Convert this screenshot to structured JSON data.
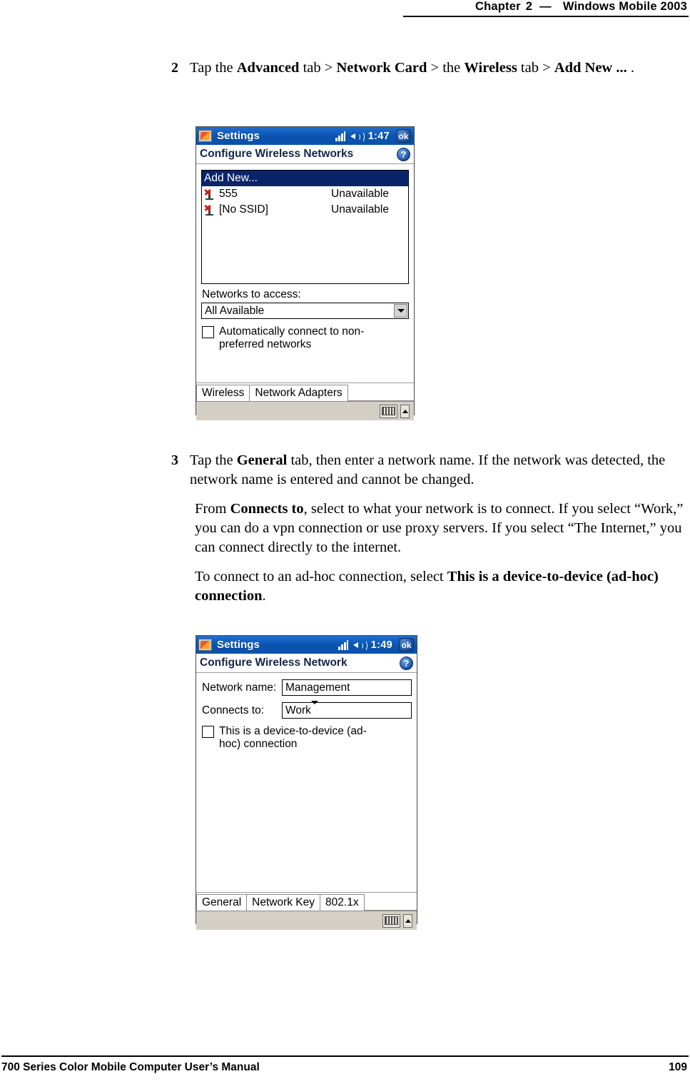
{
  "header": {
    "chapter_word": "Chapter",
    "chapter_number": "2",
    "dash": "—",
    "title": "Windows Mobile 2003"
  },
  "footer": {
    "manual_title": "700 Series Color Mobile Computer User’s Manual",
    "page_number": "109"
  },
  "steps": [
    {
      "number": "2",
      "text_html": "Tap the <b>Advanced</b> tab &gt; <b>Network Card</b> &gt; the <b>Wireless</b> tab &gt; <b>Add New ... </b>."
    },
    {
      "number": "3",
      "text_html": "Tap the <b>General</b> tab, then enter a network name. If the network was detected, the network name is entered and cannot be changed."
    }
  ],
  "paragraphs": [
    "From <b>Connects to</b>, select to what your network is to connect. If you select “Work,” you can do a vpn connection or use proxy servers. If you select “The Internet,” you can connect directly to the internet.",
    "To connect to an ad-hoc connection, select <b>This is a device-to-device (ad-hoc) connection</b>."
  ],
  "screenshot1": {
    "titlebar": {
      "title": "Settings",
      "clock": "1:47",
      "ok_label": "ok"
    },
    "subtitle": "Configure Wireless Networks",
    "help_label": "?",
    "list": [
      {
        "name": "Add New...",
        "status": "",
        "selected": true,
        "has_icon": false
      },
      {
        "name": "555",
        "status": "Unavailable",
        "selected": false,
        "has_icon": true
      },
      {
        "name": "[No SSID]",
        "status": "Unavailable",
        "selected": false,
        "has_icon": true
      }
    ],
    "networks_label": "Networks to access:",
    "networks_value": "All Available",
    "checkbox_label": "Automatically connect to non-preferred networks",
    "checkbox_checked": false,
    "tabs": [
      {
        "label": "Wireless",
        "active": true
      },
      {
        "label": "Network Adapters",
        "active": false
      }
    ]
  },
  "screenshot2": {
    "titlebar": {
      "title": "Settings",
      "clock": "1:49",
      "ok_label": "ok"
    },
    "subtitle": "Configure Wireless Network",
    "help_label": "?",
    "fields": [
      {
        "label": "Network name:",
        "value": "Management",
        "type": "text"
      },
      {
        "label": "Connects to:",
        "value": "Work",
        "type": "combo"
      }
    ],
    "checkbox_label": "This is a device-to-device (ad-hoc) connection",
    "checkbox_checked": false,
    "tabs": [
      {
        "label": "General",
        "active": true
      },
      {
        "label": "Network Key",
        "active": false
      },
      {
        "label": "802.1x",
        "active": false
      }
    ]
  }
}
